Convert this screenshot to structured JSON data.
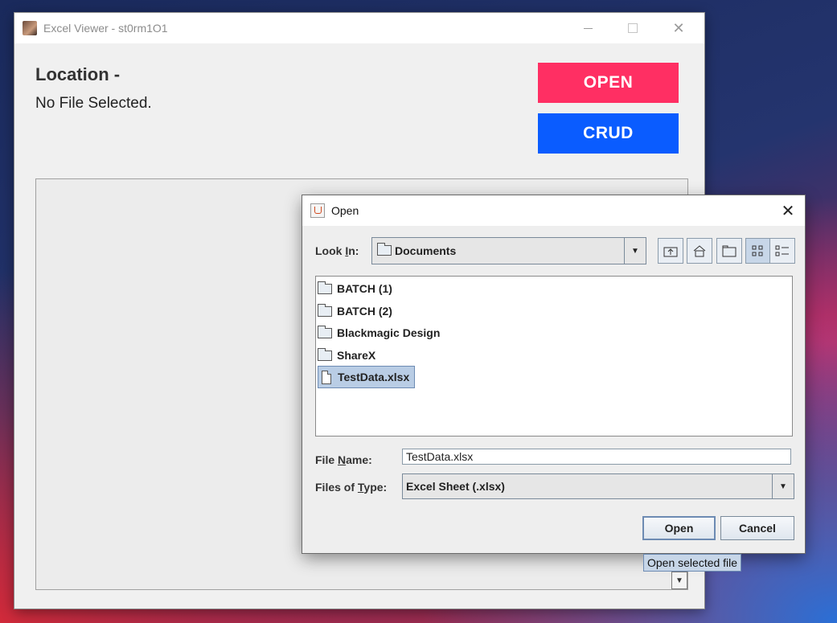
{
  "main_window": {
    "title": "Excel Viewer - st0rm1O1",
    "location_label": "Location -",
    "location_value": "No File Selected.",
    "open_button": "OPEN",
    "crud_button": "CRUD",
    "colors": {
      "open_button": "#ff2f63",
      "crud_button": "#0a5cff"
    }
  },
  "dialog": {
    "title": "Open",
    "look_in": {
      "label_pre": "Look ",
      "label_mnemonic": "I",
      "label_post": "n:",
      "value": "Documents"
    },
    "files": [
      {
        "name": "BATCH (1)",
        "type": "folder",
        "selected": false
      },
      {
        "name": "BATCH (2)",
        "type": "folder",
        "selected": false
      },
      {
        "name": "Blackmagic Design",
        "type": "folder",
        "selected": false
      },
      {
        "name": "ShareX",
        "type": "folder",
        "selected": false
      },
      {
        "name": "TestData.xlsx",
        "type": "file",
        "selected": true
      }
    ],
    "file_name": {
      "label_pre": "File ",
      "label_mnemonic": "N",
      "label_post": "ame:",
      "value": "TestData.xlsx"
    },
    "file_type": {
      "label_pre": "Files of ",
      "label_mnemonic": "T",
      "label_post": "ype:",
      "value": "Excel Sheet (.xlsx)"
    },
    "open_button": "Open",
    "cancel_button": "Cancel",
    "tooltip": "Open selected file"
  }
}
